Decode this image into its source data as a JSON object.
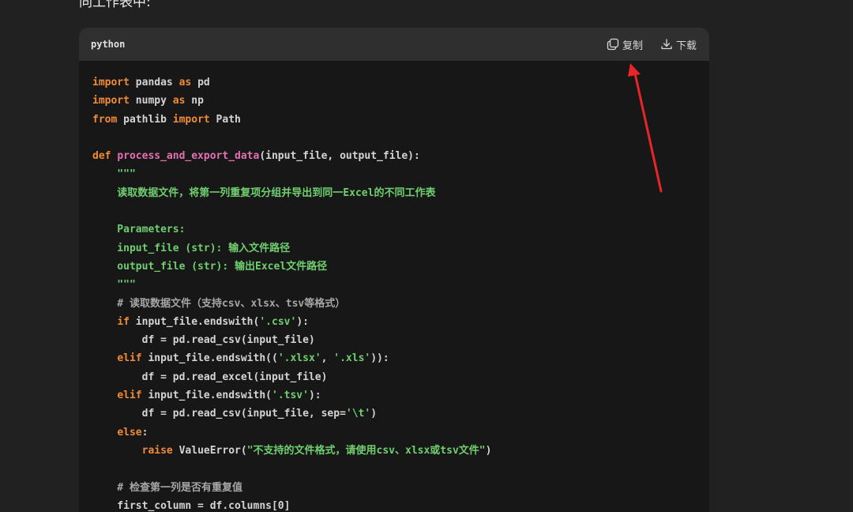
{
  "intro": {
    "text": "同工作表中:"
  },
  "code_block": {
    "language": "python",
    "copy_label": "复制",
    "download_label": "下载",
    "icons": [
      "copy-icon",
      "download-icon"
    ],
    "lines": [
      [
        {
          "t": "import",
          "c": "kw"
        },
        {
          "t": " pandas "
        },
        {
          "t": "as",
          "c": "kw"
        },
        {
          "t": " pd"
        }
      ],
      [
        {
          "t": "import",
          "c": "kw"
        },
        {
          "t": " numpy "
        },
        {
          "t": "as",
          "c": "kw"
        },
        {
          "t": " np"
        }
      ],
      [
        {
          "t": "from",
          "c": "kw"
        },
        {
          "t": " pathlib "
        },
        {
          "t": "import",
          "c": "kw"
        },
        {
          "t": " Path"
        }
      ],
      [],
      [
        {
          "t": "def",
          "c": "kw"
        },
        {
          "t": " "
        },
        {
          "t": "process_and_export_data",
          "c": "fn"
        },
        {
          "t": "(input_file, output_file):"
        }
      ],
      [
        {
          "t": "    \"\"\"",
          "c": "str"
        }
      ],
      [
        {
          "t": "    读取数据文件，将第一列重复项分组并导出到同一Excel的不同工作表",
          "c": "str"
        }
      ],
      [],
      [
        {
          "t": "    Parameters:",
          "c": "str"
        }
      ],
      [
        {
          "t": "    input_file (str): 输入文件路径",
          "c": "str"
        }
      ],
      [
        {
          "t": "    output_file (str): 输出Excel文件路径",
          "c": "str"
        }
      ],
      [
        {
          "t": "    \"\"\"",
          "c": "str"
        }
      ],
      [
        {
          "t": "    # 读取数据文件（支持csv、xlsx、tsv等格式）",
          "c": "cm"
        }
      ],
      [
        {
          "t": "    "
        },
        {
          "t": "if",
          "c": "kw"
        },
        {
          "t": " input_file.endswith("
        },
        {
          "t": "'.csv'",
          "c": "str"
        },
        {
          "t": "):"
        }
      ],
      [
        {
          "t": "        df = pd.read_csv(input_file)"
        }
      ],
      [
        {
          "t": "    "
        },
        {
          "t": "elif",
          "c": "kw"
        },
        {
          "t": " input_file.endswith(("
        },
        {
          "t": "'.xlsx'",
          "c": "str"
        },
        {
          "t": ", "
        },
        {
          "t": "'.xls'",
          "c": "str"
        },
        {
          "t": ")):"
        }
      ],
      [
        {
          "t": "        df = pd.read_excel(input_file)"
        }
      ],
      [
        {
          "t": "    "
        },
        {
          "t": "elif",
          "c": "kw"
        },
        {
          "t": " input_file.endswith("
        },
        {
          "t": "'.tsv'",
          "c": "str"
        },
        {
          "t": "):"
        }
      ],
      [
        {
          "t": "        df = pd.read_csv(input_file, sep="
        },
        {
          "t": "'\\t'",
          "c": "str"
        },
        {
          "t": ")"
        }
      ],
      [
        {
          "t": "    "
        },
        {
          "t": "else",
          "c": "kw"
        },
        {
          "t": ":"
        }
      ],
      [
        {
          "t": "        "
        },
        {
          "t": "raise",
          "c": "kw"
        },
        {
          "t": " ValueError("
        },
        {
          "t": "\"不支持的文件格式，请使用csv、xlsx或tsv文件\"",
          "c": "str"
        },
        {
          "t": ")"
        }
      ],
      [],
      [
        {
          "t": "    # 检查第一列是否有重复值",
          "c": "cm"
        }
      ],
      [
        {
          "t": "    first_column = df.columns[0]"
        }
      ]
    ]
  },
  "colors": {
    "page_bg": "#212121",
    "code_bg": "#171717",
    "header_bg": "#2f2f2f",
    "keyword": "#f08b36",
    "function": "#e56fb3",
    "string": "#6fcf6f",
    "comment": "#a6a6a6",
    "arrow": "#e8262a"
  }
}
